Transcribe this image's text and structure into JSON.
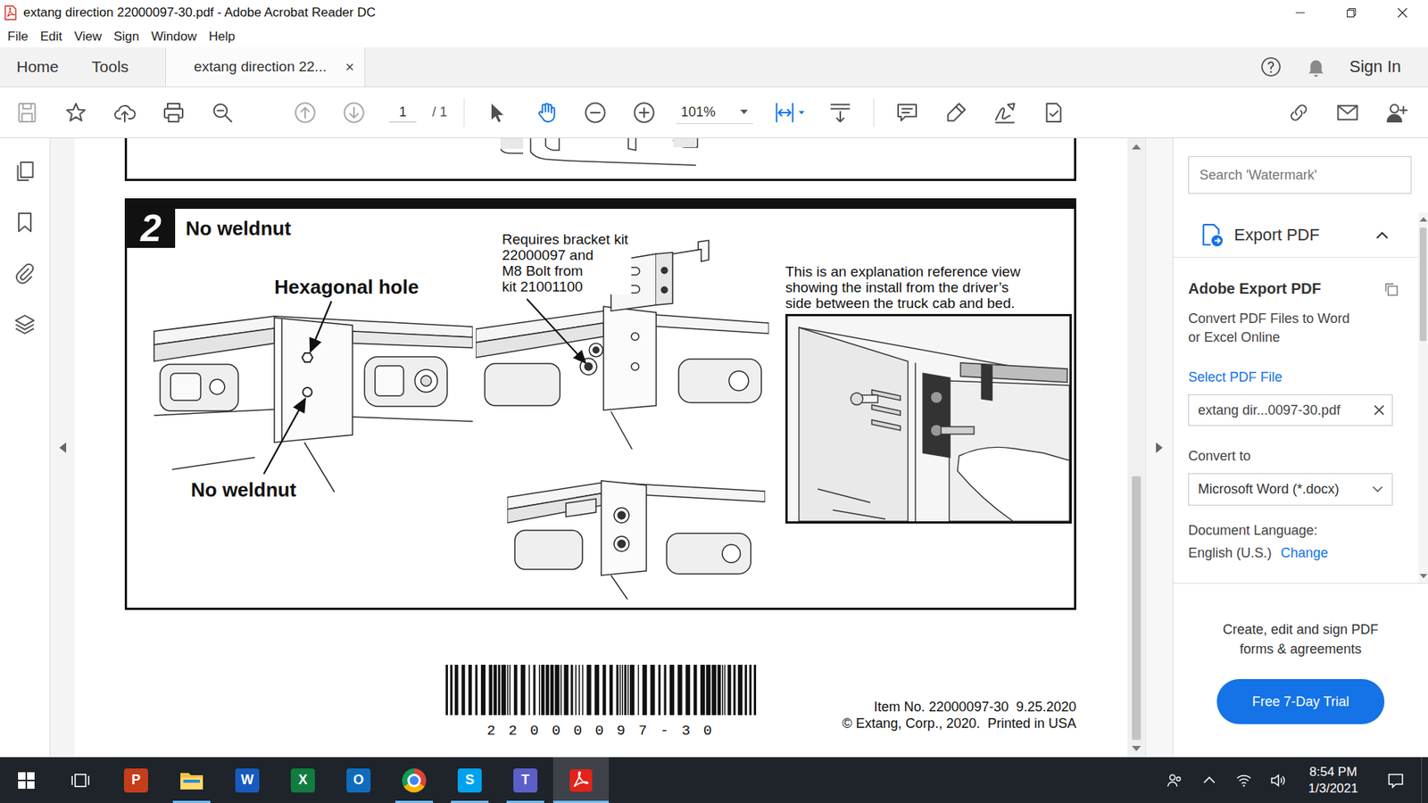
{
  "window": {
    "title": "extang direction 22000097-30.pdf - Adobe Acrobat Reader DC"
  },
  "menu": [
    "File",
    "Edit",
    "View",
    "Sign",
    "Window",
    "Help"
  ],
  "tabs": [
    {
      "label": "Home",
      "selected": false
    },
    {
      "label": "Tools",
      "selected": false
    },
    {
      "label": "extang direction 22...",
      "selected": true,
      "close": "×"
    }
  ],
  "account": {
    "sign_in": "Sign In"
  },
  "toolbar": {
    "page": "1",
    "page_total": "/ 1",
    "zoom": "101%",
    "tools": [
      {
        "kind": "select",
        "selected": false
      },
      {
        "kind": "hand",
        "selected": true
      }
    ]
  },
  "document": {
    "step": {
      "number": "2",
      "title": "No weldnut",
      "hex_label": "Hexagonal hole",
      "weldnut_label": "No weldnut",
      "bracket_note": [
        "Requires bracket kit",
        "22000097 and",
        "M8 Bolt from",
        "kit 21001100"
      ],
      "reference_note": [
        "This is an explanation reference view",
        "showing the install from the driver’s",
        "side between the truck cab and bed."
      ]
    },
    "barcode": "2 2 0 0 0 0 9 7 - 3 0",
    "footer": [
      "Item No. 22000097-30  9.25.2020",
      "© Extang, Corp., 2020.  Printed in USA"
    ]
  },
  "side_panel": {
    "search_placeholder": "Search 'Watermark'",
    "section": {
      "title": "Export PDF",
      "expanded": true
    },
    "heading": "Adobe Export PDF",
    "description": [
      "Convert PDF Files to Word",
      "or Excel Online"
    ],
    "select_label": "Select PDF File",
    "file_name": "extang dir...0097-30.pdf",
    "convert_label": "Convert to",
    "format": "Microsoft Word (*.docx)",
    "language_label": "Document Language:",
    "language": "English (U.S.)",
    "language_action": "Change",
    "promo": [
      "Create, edit and sign PDF",
      "forms & agreements"
    ],
    "promo_button": "Free 7-Day Trial"
  },
  "taskbar": {
    "apps": [
      {
        "kind": "tile",
        "glyph": "P",
        "color": "#c43e1c",
        "running": false,
        "selected": false
      },
      {
        "kind": "folder",
        "color": "#f3c13a",
        "running": true,
        "selected": false
      },
      {
        "kind": "tile",
        "glyph": "W",
        "color": "#185abd",
        "running": false,
        "selected": false
      },
      {
        "kind": "tile",
        "glyph": "X",
        "color": "#107c41",
        "running": false,
        "selected": false
      },
      {
        "kind": "tile",
        "glyph": "O",
        "color": "#0f6cbd",
        "running": false,
        "selected": false
      },
      {
        "kind": "chrome",
        "color": "#db4437",
        "running": true,
        "selected": false
      },
      {
        "kind": "tile",
        "glyph": "S",
        "color": "#00a2ed",
        "running": true,
        "selected": false
      },
      {
        "kind": "tile",
        "glyph": "T",
        "color": "#5b5fc7",
        "running": true,
        "selected": false
      },
      {
        "kind": "acrobat",
        "color": "#e2231a",
        "running": true,
        "selected": true
      }
    ],
    "time": "8:54 PM",
    "date": "1/3/2021"
  }
}
